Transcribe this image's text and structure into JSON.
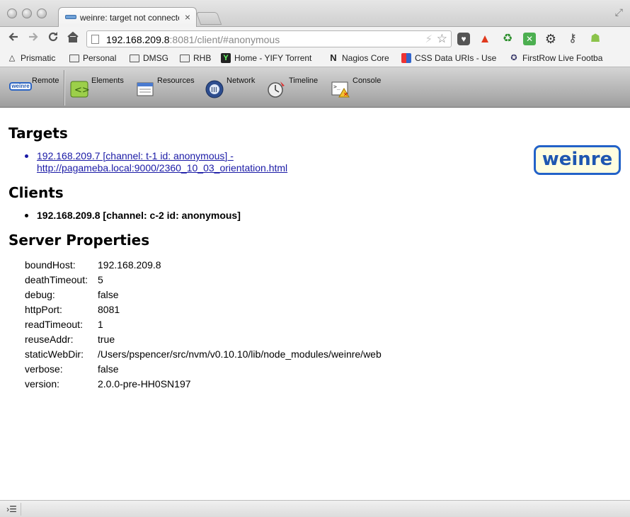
{
  "window": {
    "tab_title": "weinre: target not connected",
    "tab_close": "×",
    "fullscreen": "⤢"
  },
  "nav": {
    "back_icon": "back-arrow-icon",
    "forward_icon": "forward-arrow-icon",
    "reload_icon": "reload-icon",
    "home_icon": "home-icon",
    "url_host": "192.168.209.8",
    "url_path": ":8081/client/#anonymous"
  },
  "extensions": [
    "pocket-icon",
    "vlc-icon",
    "wrench-tree-icon",
    "excel-icon",
    "gear-icon",
    "key-icon",
    "android-icon"
  ],
  "bookmarks": [
    {
      "label": "Prismatic",
      "icon": "prismatic-icon"
    },
    {
      "label": "Personal",
      "icon": "folder-icon"
    },
    {
      "label": "DMSG",
      "icon": "folder-icon"
    },
    {
      "label": "RHB",
      "icon": "folder-icon"
    },
    {
      "label": "Home - YIFY Torrent",
      "icon": "yify-icon"
    },
    {
      "label": "Nagios Core",
      "icon": "nagios-icon"
    },
    {
      "label": "CSS Data URIs - Use",
      "icon": "css-icon"
    },
    {
      "label": "FirstRow Live Footba",
      "icon": "firstrow-icon"
    }
  ],
  "weinre_toolbar": {
    "remote": "Remote",
    "remote_logo": "weinre",
    "elements": "Elements",
    "resources": "Resources",
    "network": "Network",
    "timeline": "Timeline",
    "console": "Console"
  },
  "content": {
    "targets_heading": "Targets",
    "target_line1": "192.168.209.7 [channel: t-1 id: anonymous] -",
    "target_line2": "http://pagameba.local:9000/2360_10_03_orientation.html",
    "logo_text": "weinre",
    "clients_heading": "Clients",
    "client_line": "192.168.209.8 [channel: c-2 id: anonymous]",
    "server_heading": "Server Properties",
    "properties": [
      {
        "key": "boundHost:",
        "value": "192.168.209.8"
      },
      {
        "key": "deathTimeout:",
        "value": "5"
      },
      {
        "key": "debug:",
        "value": "false"
      },
      {
        "key": "httpPort:",
        "value": "8081"
      },
      {
        "key": "readTimeout:",
        "value": "1"
      },
      {
        "key": "reuseAddr:",
        "value": "true"
      },
      {
        "key": "staticWebDir:",
        "value": "/Users/pspencer/src/nvm/v0.10.10/lib/node_modules/weinre/web"
      },
      {
        "key": "verbose:",
        "value": "false"
      },
      {
        "key": "version:",
        "value": "2.0.0-pre-HH0SN197"
      }
    ]
  },
  "statusbar": {
    "console_toggle": "›☰"
  },
  "colors": {
    "link": "#1a1aa6",
    "weinre_blue": "#2362c8",
    "target_bullet": "#1a1aa6"
  }
}
